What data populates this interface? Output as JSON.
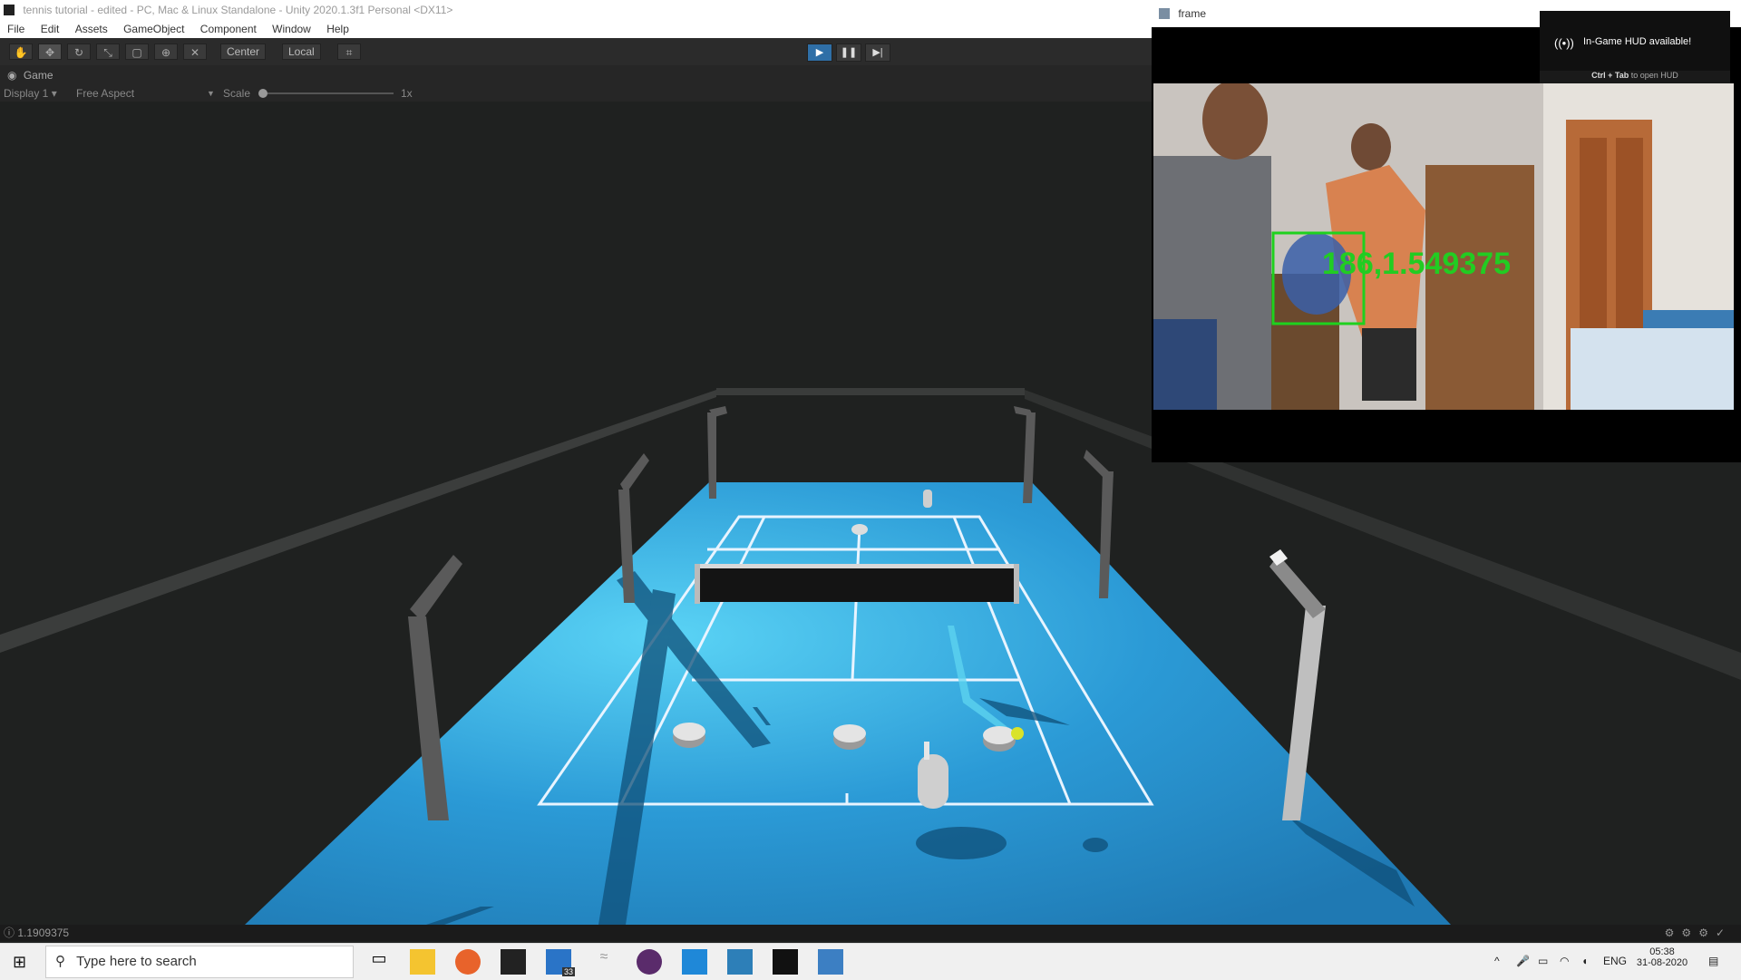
{
  "window": {
    "title": "tennis tutorial - edited - PC, Mac & Linux Standalone - Unity 2020.1.3f1 Personal <DX11>"
  },
  "menu": [
    "File",
    "Edit",
    "Assets",
    "GameObject",
    "Component",
    "Window",
    "Help"
  ],
  "toolbar": {
    "tools": [
      "hand-tool-icon",
      "move-tool-icon",
      "rotate-tool-icon",
      "scale-tool-icon",
      "rect-tool-icon",
      "transform-tool-icon",
      "custom-tool-icon"
    ],
    "pivot_mode": "Center",
    "pivot_rotation": "Local",
    "play_state": "playing"
  },
  "game_view": {
    "tab_label": "Game",
    "display": "Display 1",
    "aspect": "Free Aspect",
    "scale_label": "Scale",
    "scale_value": "1x"
  },
  "status": {
    "message": "1.1909375"
  },
  "frame_window": {
    "title": "frame",
    "overlay_text": "186,1.549375",
    "overlay_color": "#22cc22"
  },
  "hud_toast": {
    "title": "In-Game HUD available!",
    "hint_keys": "Ctrl + Tab",
    "hint_text": "to open HUD"
  },
  "taskbar": {
    "search_placeholder": "Type here to search",
    "badge_count": "33",
    "language": "ENG",
    "time": "05:38",
    "date": "31-08-2020"
  },
  "colors": {
    "court": "#2a8fd0",
    "court_light": "#4cc1ee",
    "background": "#1f2120",
    "unity_play": "#2f6fa7"
  }
}
